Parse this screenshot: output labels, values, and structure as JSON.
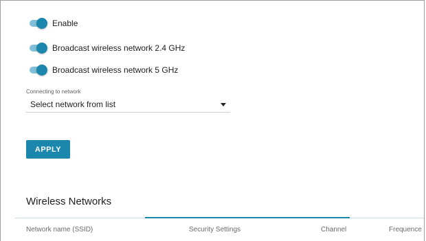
{
  "toggles": [
    {
      "label": "Enable",
      "on": true
    },
    {
      "label": "Broadcast wireless network 2.4 GHz",
      "on": true
    },
    {
      "label": "Broadcast wireless network 5 GHz",
      "on": true
    }
  ],
  "network_select": {
    "label": "Connecting to network",
    "value": "Select network from list"
  },
  "apply_label": "APPLY",
  "wireless_networks": {
    "title": "Wireless Networks",
    "columns": [
      "Network name (SSID)",
      "Security Settings",
      "Channel",
      "Frequence"
    ]
  },
  "colors": {
    "accent": "#1b87ad",
    "track": "#7fc0d8"
  }
}
